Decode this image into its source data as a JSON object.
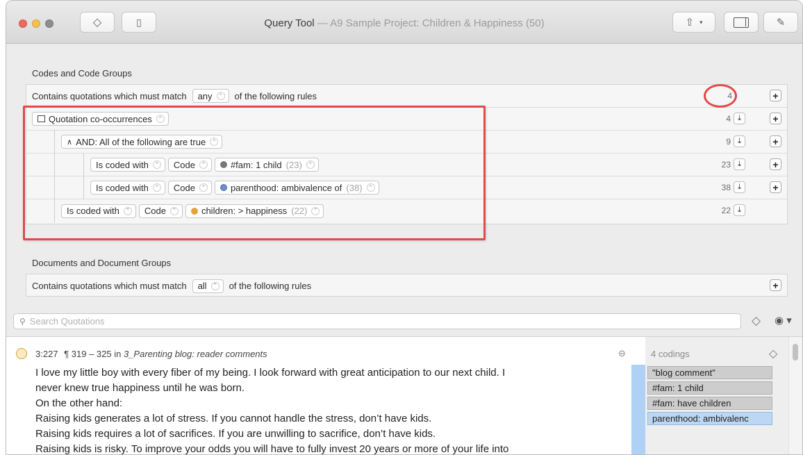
{
  "window": {
    "title": "Query Tool",
    "subtitle": " — A9 Sample Project: Children & Happiness (50)"
  },
  "codes_section": {
    "label": "Codes and Code Groups",
    "root_prefix": "Contains quotations which must match",
    "root_match": "any",
    "root_suffix": "of the following rules",
    "root_count": "4",
    "cooccurrence_label": "Quotation co-occurrences",
    "cooccurrence_count": "4",
    "and_label": "AND: All of the following are true",
    "and_count": "9",
    "rules": [
      {
        "operator": "Is coded with",
        "type": "Code",
        "code": "#fam: 1 child",
        "code_count": "(23)",
        "count": "23",
        "color": "#777777"
      },
      {
        "operator": "Is coded with",
        "type": "Code",
        "code": "parenthood: ambivalence of",
        "code_count": "(38)",
        "count": "38",
        "color": "#6d8fc9"
      },
      {
        "operator": "Is coded with",
        "type": "Code",
        "code": "children: > happiness",
        "code_count": "(22)",
        "count": "22",
        "color": "#e6a040"
      }
    ]
  },
  "documents_section": {
    "label": "Documents and Document Groups",
    "prefix": "Contains quotations which must match",
    "match": "all",
    "suffix": "of the following rules"
  },
  "search": {
    "placeholder": "Search Quotations"
  },
  "quotation": {
    "id": "3:227",
    "range": "¶ 319 – 325 in",
    "document": "3_Parenting blog: reader comments",
    "lines": [
      "I love my little boy with every fiber of my being. I look forward with great anticipation to our next child. I",
      "never knew true happiness until he was born.",
      "On the other hand:",
      "Raising kids generates a lot of stress. If you cannot handle the stress, don’t have kids.",
      "Raising kids requires a lot of sacrifices. If you are unwilling to sacrifice, don’t have kids.",
      "Raising kids is risky. To improve your odds you will have to fully invest 20 years or more of your life into"
    ],
    "codings_title": "4 codings",
    "codings": [
      "\"blog comment\"",
      "#fam: 1 child",
      "#fam: have children",
      "parenthood: ambivalenc"
    ]
  },
  "icons": {
    "share": "share-icon",
    "sidebar": "sidebar-icon",
    "pin": "pin-icon",
    "tag": "tag-icon",
    "book": "book-icon",
    "download": "download-icon",
    "plus": "plus-icon",
    "eye": "eye-icon",
    "search": "search-icon"
  }
}
